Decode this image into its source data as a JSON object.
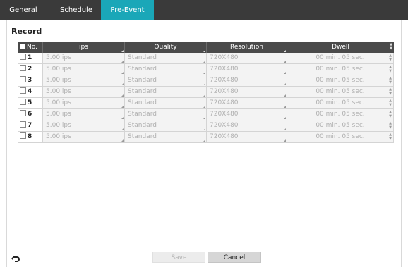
{
  "tabs": [
    {
      "label": "General",
      "active": false
    },
    {
      "label": "Schedule",
      "active": false
    },
    {
      "label": "Pre-Event",
      "active": true
    }
  ],
  "section": {
    "title": "Record"
  },
  "table": {
    "headers": {
      "no": "No.",
      "ips": "ips",
      "quality": "Quality",
      "resolution": "Resolution",
      "dwell": "Dwell"
    },
    "rows": [
      {
        "no": "1",
        "ips": "5.00 ips",
        "quality": "Standard",
        "resolution": "720X480",
        "dwell": "00 min. 05 sec."
      },
      {
        "no": "2",
        "ips": "5.00 ips",
        "quality": "Standard",
        "resolution": "720X480",
        "dwell": "00 min. 05 sec."
      },
      {
        "no": "3",
        "ips": "5.00 ips",
        "quality": "Standard",
        "resolution": "720X480",
        "dwell": "00 min. 05 sec."
      },
      {
        "no": "4",
        "ips": "5.00 ips",
        "quality": "Standard",
        "resolution": "720X480",
        "dwell": "00 min. 05 sec."
      },
      {
        "no": "5",
        "ips": "5.00 ips",
        "quality": "Standard",
        "resolution": "720X480",
        "dwell": "00 min. 05 sec."
      },
      {
        "no": "6",
        "ips": "5.00 ips",
        "quality": "Standard",
        "resolution": "720X480",
        "dwell": "00 min. 05 sec."
      },
      {
        "no": "7",
        "ips": "5.00 ips",
        "quality": "Standard",
        "resolution": "720X480",
        "dwell": "00 min. 05 sec."
      },
      {
        "no": "8",
        "ips": "5.00 ips",
        "quality": "Standard",
        "resolution": "720X480",
        "dwell": "00 min. 05 sec."
      }
    ]
  },
  "footer": {
    "save_label": "Save",
    "cancel_label": "Cancel",
    "back_icon": "undo-arrow-icon"
  },
  "colors": {
    "tab_active": "#1aa7b8",
    "tab_bar": "#3a3a3a",
    "header_bg": "#4a4a4a"
  }
}
